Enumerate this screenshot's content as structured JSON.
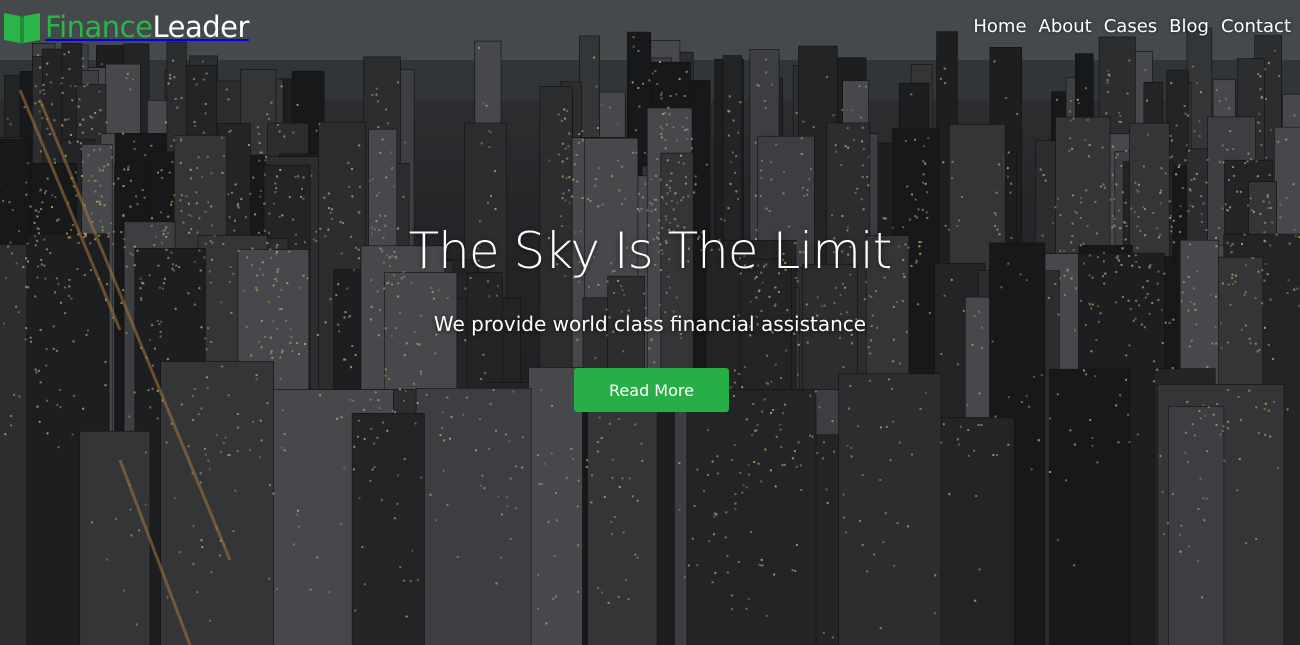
{
  "brand": {
    "name_part1": "Finance",
    "name_part2": "Leader",
    "logo_icon": "book-icon",
    "accent_color": "#2bb548"
  },
  "nav": {
    "items": [
      {
        "label": "Home"
      },
      {
        "label": "About"
      },
      {
        "label": "Cases"
      },
      {
        "label": "Blog"
      },
      {
        "label": "Contact"
      }
    ]
  },
  "hero": {
    "title": "The Sky Is The Limit",
    "subtitle": "We provide world class financial assistance",
    "button_label": "Read More",
    "button_color": "#27ae47",
    "background": "city-skyline-night-photo"
  }
}
